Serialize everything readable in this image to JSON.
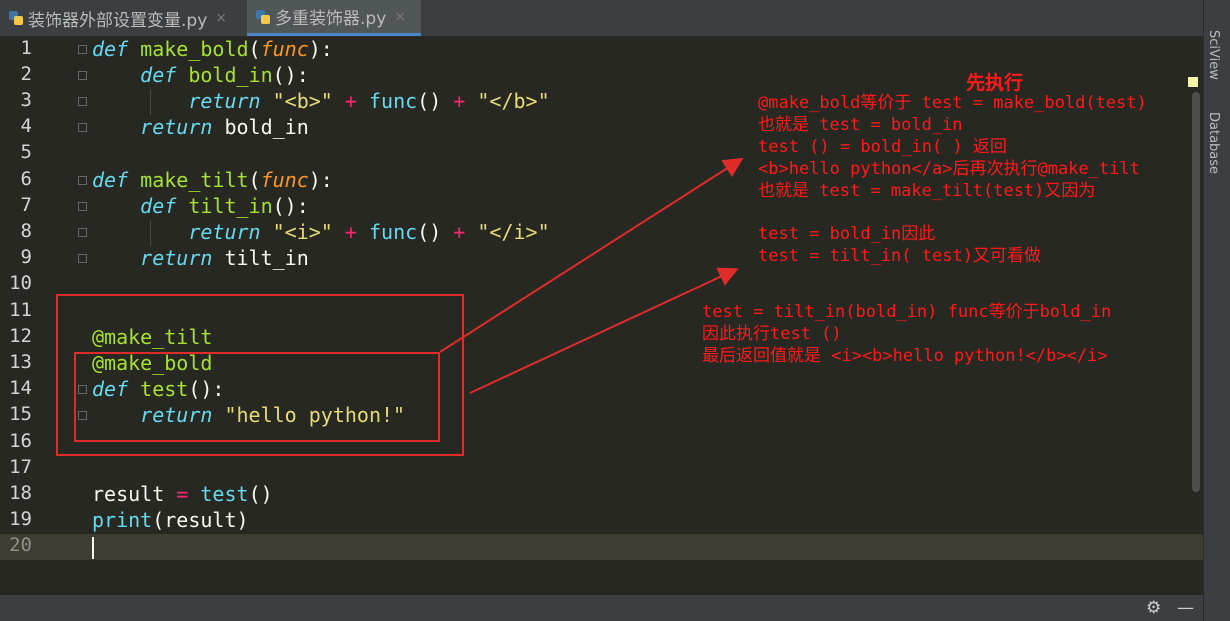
{
  "tabs": [
    {
      "label": "装饰器外部设置变量.py",
      "active": false
    },
    {
      "label": "多重装饰器.py",
      "active": true
    }
  ],
  "tab_close": "×",
  "side_tabs": {
    "sciview": "SciView",
    "database": "Database"
  },
  "line_numbers": [
    "1",
    "2",
    "3",
    "4",
    "5",
    "6",
    "7",
    "8",
    "9",
    "10",
    "11",
    "12",
    "13",
    "14",
    "15",
    "16",
    "17",
    "18",
    "19",
    "20"
  ],
  "code": {
    "l1": {
      "kw": "def",
      "name": "make_bold",
      "p1": "(",
      "param": "func",
      "p2": "):"
    },
    "l2": {
      "kw": "def",
      "name": "bold_in",
      "rest": "():"
    },
    "l3": {
      "kw": "return",
      "s1": "\"<b>\"",
      "op1": "+",
      "call": "func",
      "paren": "()",
      "op2": "+",
      "s2": "\"</b>\""
    },
    "l4": {
      "kw": "return",
      "rest": "bold_in"
    },
    "l6": {
      "kw": "def",
      "name": "make_tilt",
      "p1": "(",
      "param": "func",
      "p2": "):"
    },
    "l7": {
      "kw": "def",
      "name": "tilt_in",
      "rest": "():"
    },
    "l8": {
      "kw": "return",
      "s1": "\"<i>\"",
      "op1": "+",
      "call": "func",
      "paren": "()",
      "op2": "+",
      "s2": "\"</i>\""
    },
    "l9": {
      "kw": "return",
      "rest": "tilt_in"
    },
    "l12": {
      "dec": "@make_tilt"
    },
    "l13": {
      "dec": "@make_bold"
    },
    "l14": {
      "kw": "def",
      "name": "test",
      "rest": "():"
    },
    "l15": {
      "kw": "return",
      "str": "\"hello python!\""
    },
    "l18": {
      "var": "result",
      "op": "=",
      "call": "test",
      "paren": "()"
    },
    "l19": {
      "builtin": "print",
      "rest": "(result)"
    }
  },
  "annotations": {
    "title": "先执行",
    "block1": [
      "@make_bold等价于 test = make_bold(test)",
      "也就是 test = bold_in",
      "test () = bold_in( ) 返回",
      "<b>hello python</a>后再次执行@make_tilt",
      "也就是 test = make_tilt(test)又因为"
    ],
    "block2": [
      "test = bold_in因此",
      "test = tilt_in( test)又可看做"
    ],
    "block3": [
      "test = tilt_in(bold_in) func等价于bold_in",
      "因此执行test ()",
      "最后返回值就是 <i><b>hello python!</b></i>"
    ]
  },
  "colors": {
    "background": "#272822",
    "keyword": "#66d9ef",
    "function": "#a6e22e",
    "string": "#e6db74",
    "operator": "#f92672",
    "parameter": "#fd971f",
    "annotation": "#ff1a1a"
  },
  "icons": {
    "settings": "gear-icon",
    "hide": "minimize-icon"
  }
}
